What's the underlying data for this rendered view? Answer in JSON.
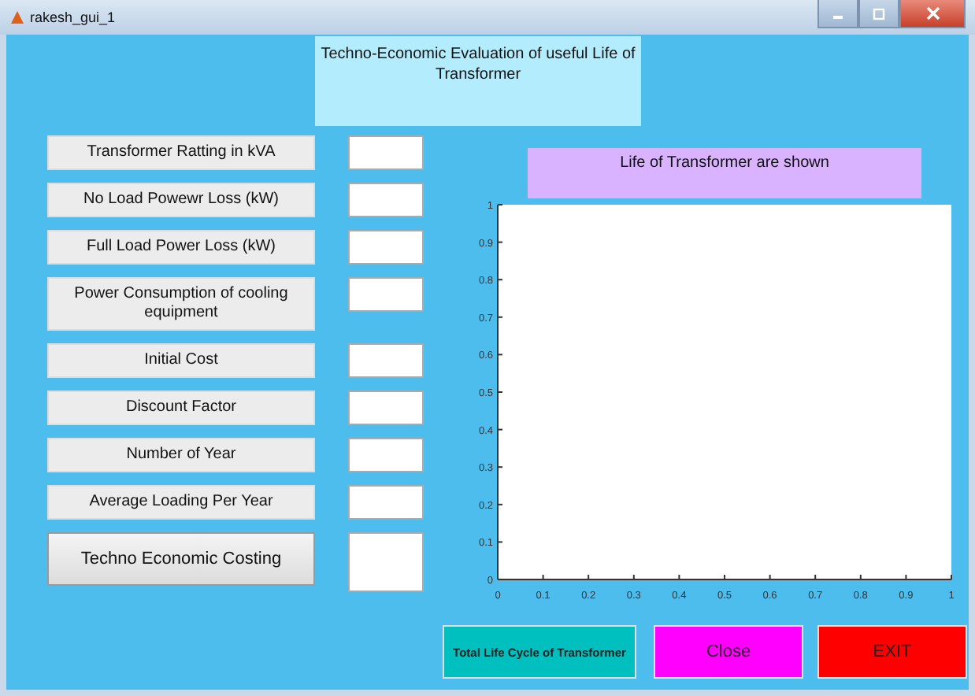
{
  "window": {
    "title": "rakesh_gui_1"
  },
  "banner": "Techno-Economic Evaluation of useful Life of Transformer",
  "inputs": [
    {
      "kind": "field",
      "label": "Transformer Ratting in kVA"
    },
    {
      "kind": "field",
      "label": "No Load Powewr Loss (kW)"
    },
    {
      "kind": "field",
      "label": "Full Load Power Loss (kW)"
    },
    {
      "kind": "field",
      "label": "Power Consumption of cooling equipment"
    },
    {
      "kind": "field",
      "label": "Initial Cost"
    },
    {
      "kind": "field",
      "label": "Discount Factor"
    },
    {
      "kind": "field",
      "label": "Number of Year"
    },
    {
      "kind": "field",
      "label": "Average Loading Per Year"
    },
    {
      "kind": "button",
      "label": "Techno Economic Costing"
    }
  ],
  "plot": {
    "title": "Life of Transformer are shown",
    "chart_data": {
      "type": "line",
      "xlim": [
        0,
        1
      ],
      "ylim": [
        0,
        1
      ],
      "xticks": [
        0,
        0.1,
        0.2,
        0.3,
        0.4,
        0.5,
        0.6,
        0.7,
        0.8,
        0.9,
        1
      ],
      "yticks": [
        0,
        0.1,
        0.2,
        0.3,
        0.4,
        0.5,
        0.6,
        0.7,
        0.8,
        0.9,
        1
      ]
    }
  },
  "buttons": [
    {
      "label": "Total Life Cycle of Transformer",
      "color": "#00bfbf"
    },
    {
      "label": "Close",
      "color": "#ff00ff"
    },
    {
      "label": "EXIT",
      "color": "#ff0000"
    }
  ]
}
